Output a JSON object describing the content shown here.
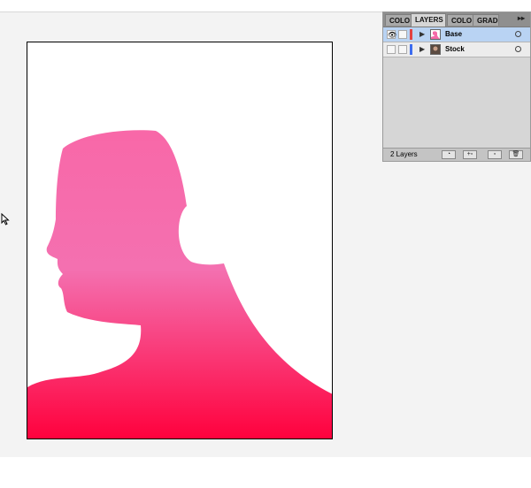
{
  "canvas": {
    "artwork_description_colors": {
      "gradient_top": "#f868a8",
      "gradient_mid": "#f470b0",
      "gradient_bottom": "#ff003c"
    }
  },
  "layers_panel": {
    "tabs": [
      {
        "label": "COLO",
        "active": false
      },
      {
        "label": "LAYERS",
        "active": true
      },
      {
        "label": "COLO",
        "active": false
      },
      {
        "label": "GRAD",
        "active": false
      }
    ],
    "menu_icon": "double-arrow-right",
    "layers": [
      {
        "name": "Base",
        "selected": true,
        "visible": true,
        "color": "#e24141"
      },
      {
        "name": "Stock",
        "selected": false,
        "visible": false,
        "color": "#3c6cf0"
      }
    ],
    "layer_count": "2 Layers",
    "footer_icons": [
      "make-clipping-mask-icon",
      "create-sublayer-icon",
      "create-layer-icon",
      "trash-icon"
    ]
  }
}
